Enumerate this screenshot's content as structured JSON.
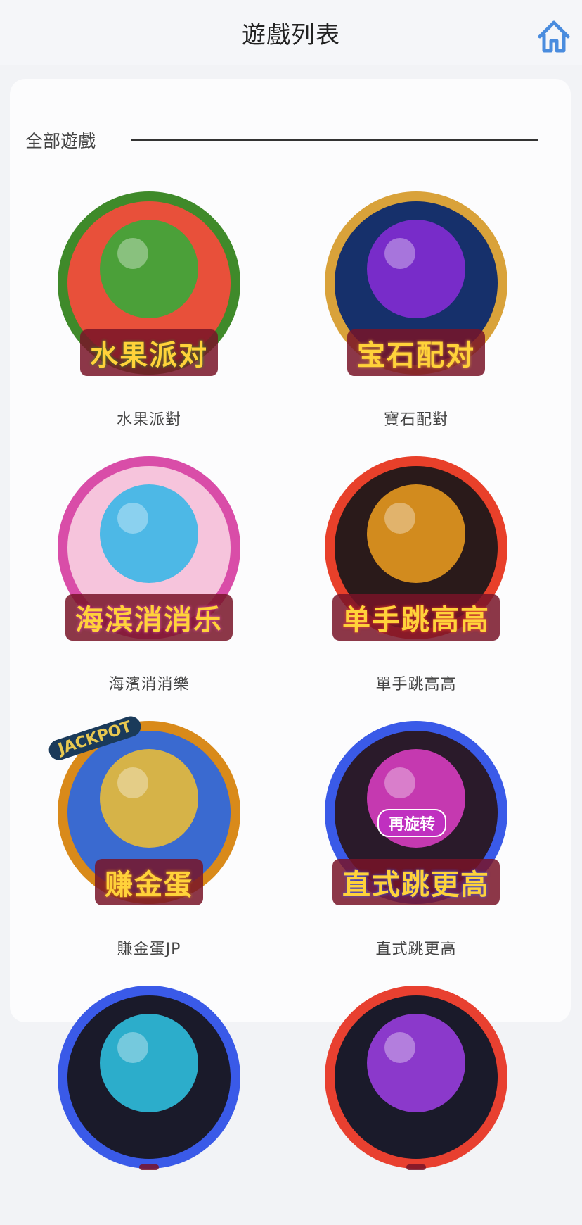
{
  "header": {
    "title": "遊戲列表",
    "home_icon": "home-icon",
    "accent": "#4a8cde"
  },
  "section": {
    "label": "全部遊戲"
  },
  "games": [
    {
      "name": "水果派對",
      "logo": "水果派对",
      "colors": {
        "ring": "#3f8a2a",
        "bg": "#e8503a",
        "accent": "#2fae3a"
      }
    },
    {
      "name": "寶石配對",
      "logo": "宝石配对",
      "colors": {
        "ring": "#d9a23a",
        "bg": "#16306b",
        "accent": "#8a2bd9"
      }
    },
    {
      "name": "海濱消消樂",
      "logo": "海滨消消乐",
      "colors": {
        "ring": "#d94da8",
        "bg": "#f6c4dc",
        "accent": "#2fb6e8"
      }
    },
    {
      "name": "單手跳高高",
      "logo": "单手跳高高",
      "colors": {
        "ring": "#e8402a",
        "bg": "#2a1a1a",
        "accent": "#f0a020"
      }
    },
    {
      "name": "賺金蛋JP",
      "logo": "赚金蛋",
      "badge": "JACKPOT",
      "colors": {
        "ring": "#d98a1a",
        "bg": "#3a6ad0",
        "accent": "#f2c030"
      }
    },
    {
      "name": "直式跳更高",
      "logo": "直式跳更高",
      "badge": "再旋转",
      "colors": {
        "ring": "#3a5ae8",
        "bg": "#2a1a2a",
        "accent": "#e040c8"
      }
    },
    {
      "name": "",
      "logo": "",
      "colors": {
        "ring": "#3a5ae8",
        "bg": "#1a1a2a",
        "accent": "#30c8e8"
      }
    },
    {
      "name": "",
      "logo": "",
      "colors": {
        "ring": "#e84030",
        "bg": "#1a1a2a",
        "accent": "#a040e8"
      }
    }
  ]
}
